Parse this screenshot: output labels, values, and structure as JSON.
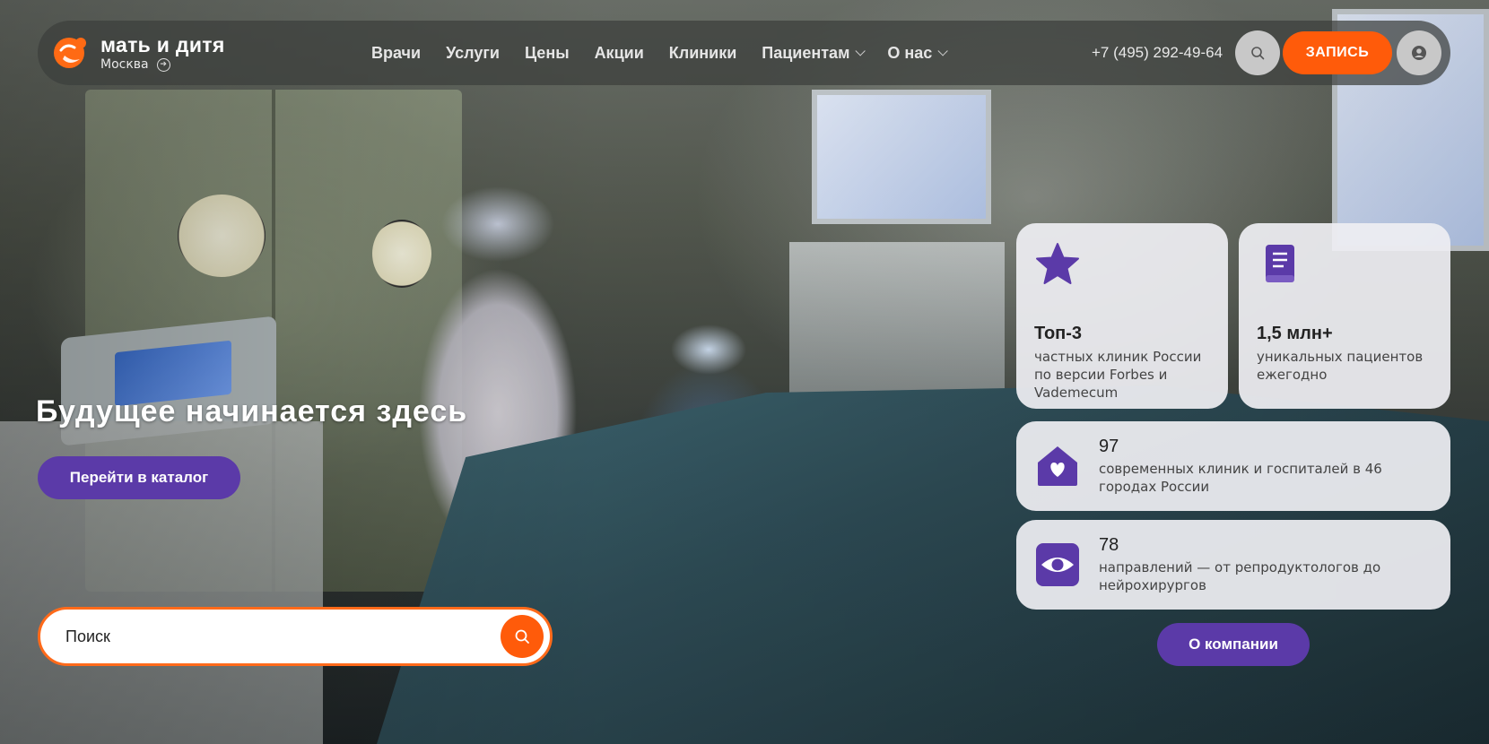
{
  "header": {
    "brand": "мать и дитя",
    "city": "Москва",
    "nav": [
      {
        "label": "Врачи",
        "dropdown": false
      },
      {
        "label": "Услуги",
        "dropdown": false
      },
      {
        "label": "Цены",
        "dropdown": false
      },
      {
        "label": "Акции",
        "dropdown": false
      },
      {
        "label": "Клиники",
        "dropdown": false
      },
      {
        "label": "Пациентам",
        "dropdown": true
      },
      {
        "label": "О нас",
        "dropdown": true
      }
    ],
    "phone": "+7 (495) 292-49-64",
    "book_label": "ЗАПИСЬ"
  },
  "hero": {
    "title": "Будущее начинается здесь",
    "catalog_label": "Перейти в каталог",
    "search_placeholder": "Поиск"
  },
  "stats": [
    {
      "value": "Топ-3",
      "desc": "частных клиник России по версии Forbes и Vademecum",
      "icon": "star-icon"
    },
    {
      "value": "1,5 млн+",
      "desc": "уникальных пациентов ежегодно",
      "icon": "book-icon"
    },
    {
      "value": "97",
      "desc": "современных клиник и госпиталей в 46 городах России",
      "icon": "house-heart-icon"
    },
    {
      "value": "78",
      "desc": "направлений — от репродуктологов до нейрохирургов",
      "icon": "eye-icon"
    }
  ],
  "about_label": "О компании",
  "colors": {
    "accent": "#ff5b0a",
    "purple": "#5b3aa8"
  }
}
